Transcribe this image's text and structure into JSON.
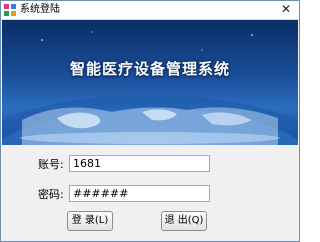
{
  "window": {
    "title": "系统登陆"
  },
  "banner": {
    "title": "智能医疗设备管理系统"
  },
  "form": {
    "account_label": "账号:",
    "account_value": "1681",
    "password_label": "密码:",
    "password_value": "######"
  },
  "buttons": {
    "login_label": "登 录(L)",
    "exit_label": "退 出(Q)"
  },
  "icons": {
    "app": "app-grid-icon",
    "close": "close-icon"
  },
  "colors": {
    "banner_dark": "#0b2e66",
    "banner_light": "#6fb1ee",
    "border": "#6e8bb0"
  }
}
